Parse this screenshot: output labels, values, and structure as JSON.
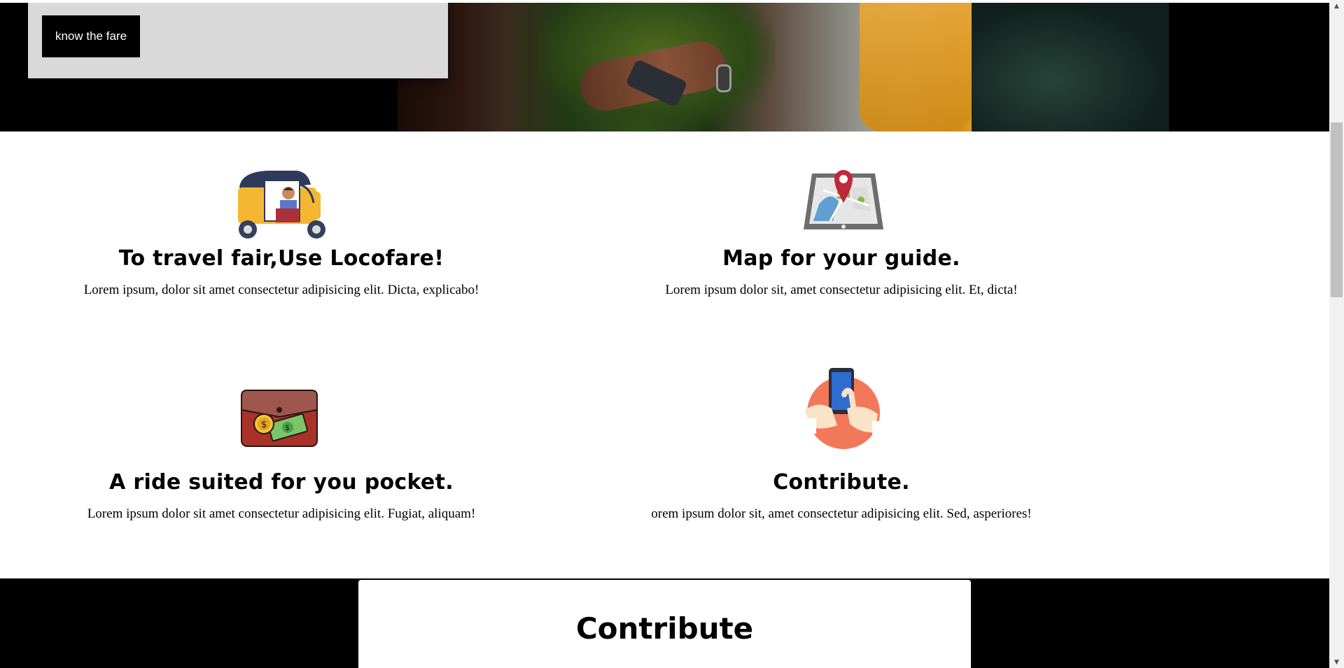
{
  "hero": {
    "button_label": "know the fare"
  },
  "features": [
    {
      "title": "To travel fair,Use Locofare!",
      "text": "Lorem ipsum, dolor sit amet consectetur adipisicing elit. Dicta, explicabo!",
      "icon": "auto-rickshaw-icon"
    },
    {
      "title": "Map for your guide.",
      "text": "Lorem ipsum dolor sit, amet consectetur adipisicing elit. Et, dicta!",
      "icon": "map-tablet-icon"
    },
    {
      "title": "A ride suited for you pocket.",
      "text": "Lorem ipsum dolor sit amet consectetur adipisicing elit. Fugiat, aliquam!",
      "icon": "wallet-icon"
    },
    {
      "title": "Contribute.",
      "text": "orem ipsum dolor sit, amet consectetur adipisicing elit. Sed, asperiores!",
      "icon": "phone-hand-icon"
    }
  ],
  "contribute": {
    "heading": "Contribute"
  },
  "colors": {
    "background": "#ffffff",
    "band": "#000000",
    "card": "#d9d9d9",
    "button": "#000000"
  }
}
